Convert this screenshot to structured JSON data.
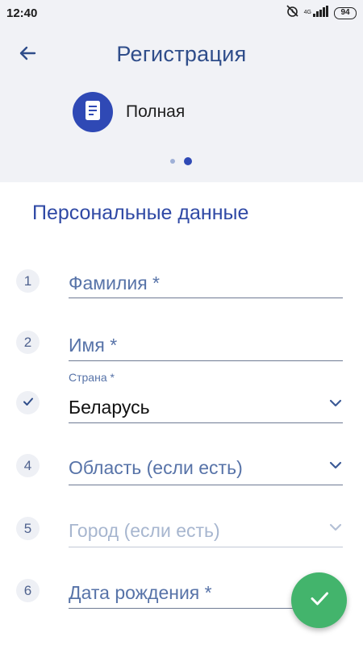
{
  "status_bar": {
    "time": "12:40",
    "network": "4G",
    "battery": "94"
  },
  "header": {
    "title": "Регистрация",
    "mode_label": "Полная",
    "page_count": 2,
    "active_page": 2
  },
  "form": {
    "section_title": "Персональные данные",
    "fields": [
      {
        "step": "1",
        "placeholder": "Фамилия *"
      },
      {
        "step": "2",
        "placeholder": "Имя *"
      },
      {
        "label": "Страна *",
        "value": "Беларусь"
      },
      {
        "step": "4",
        "placeholder": "Область (если есть)"
      },
      {
        "step": "5",
        "placeholder": "Город (если есть)"
      },
      {
        "step": "6",
        "placeholder": "Дата рождения *"
      }
    ]
  },
  "colors": {
    "primary": "#2f49b5",
    "title": "#2f4d8a",
    "fab": "#43b46c",
    "header_bg": "#f1f2f6"
  },
  "icons": {
    "back": "arrow-left-icon",
    "mode": "document-icon",
    "dropdown": "chevron-down-icon",
    "done": "checkmark-icon"
  }
}
